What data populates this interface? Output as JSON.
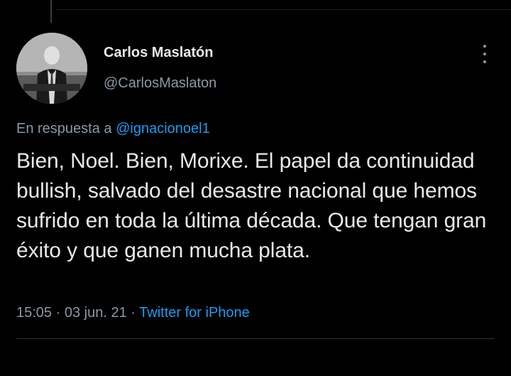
{
  "author": {
    "name": "Carlos Maslatón",
    "handle": "@CarlosMaslaton"
  },
  "reply": {
    "prefix": "En respuesta a",
    "mention": "@ignacionoel1"
  },
  "tweet": {
    "text": "Bien, Noel. Bien, Morixe. El papel da continuidad bullish, salvado del desastre nacional que hemos sufrido en toda la última década. Que tengan gran éxito y que ganen mucha plata."
  },
  "meta": {
    "time": "15:05",
    "separator": "·",
    "date": "03 jun. 21",
    "source": "Twitter for iPhone"
  },
  "icons": {
    "more": "more-vertical-icon"
  },
  "colors": {
    "background": "#000000",
    "text_primary": "#e7e9ea",
    "text_secondary": "#8b98a5",
    "link": "#1d9bf0"
  }
}
